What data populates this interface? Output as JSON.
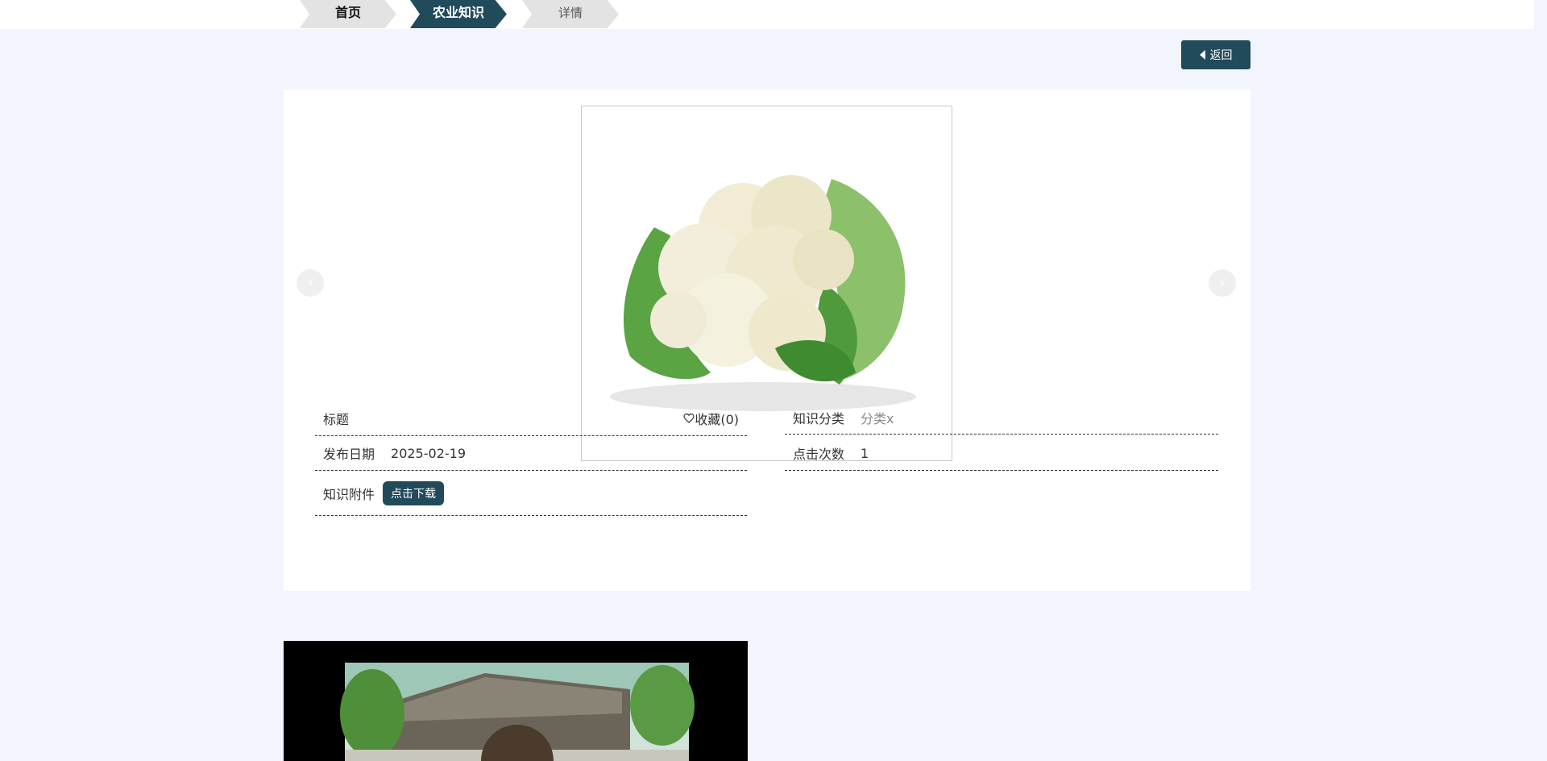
{
  "breadcrumb": {
    "home": "首页",
    "section": "农业知识",
    "current": "详情"
  },
  "actions": {
    "back_label": "返回"
  },
  "carousel": {
    "prev_label": "‹",
    "next_label": "›"
  },
  "details": {
    "title_label": "标题",
    "title_value": "",
    "favorite_label": "收藏(0)",
    "category_label": "知识分类",
    "category_value": "分类x",
    "publish_date_label": "发布日期",
    "publish_date_value": "2025-02-19",
    "clicks_label": "点击次数",
    "clicks_value": "1",
    "attachment_label": "知识附件",
    "download_label": "点击下载"
  },
  "colors": {
    "accent": "#214a5b",
    "page_bg": "#f2f5fd"
  },
  "icons": {
    "favorite": "heart-outline-icon",
    "back": "caret-left-icon"
  }
}
